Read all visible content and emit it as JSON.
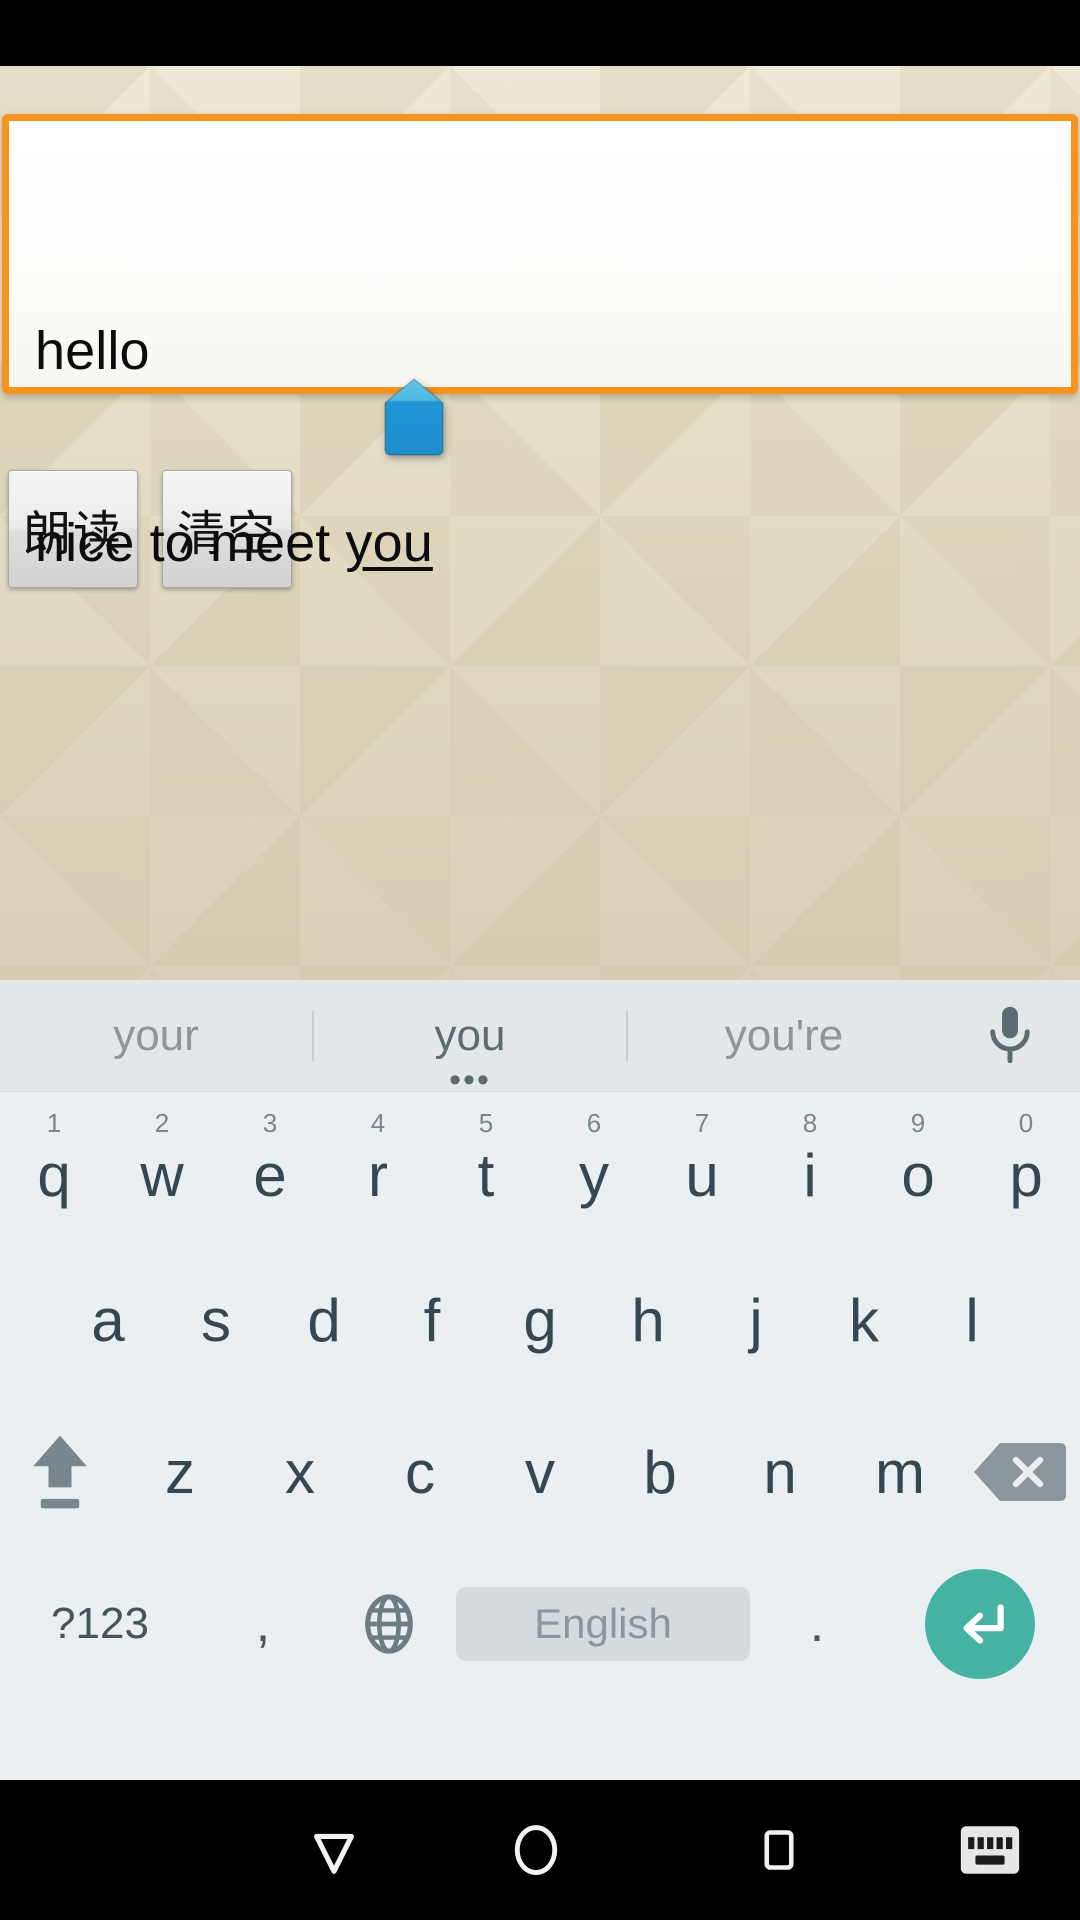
{
  "app": {
    "background_color": "#e2dac5",
    "accent_color": "#f6941e"
  },
  "editor": {
    "line1": "hello",
    "line2_prefix": "nice to meet ",
    "line2_composing": "you",
    "handle_icon": "text-cursor-handle-icon"
  },
  "buttons": [
    {
      "label": "朗读",
      "name": "read-aloud-button"
    },
    {
      "label": "清空",
      "name": "clear-button"
    }
  ],
  "keyboard": {
    "language_label": "English",
    "symbols_key": "?123",
    "comma_key": ",",
    "period_key": ".",
    "globe_icon": "globe-icon",
    "enter_icon": "enter-return-icon",
    "shift_icon": "shift-up-arrow-icon",
    "backspace_icon": "backspace-delete-icon",
    "mic_icon": "microphone-icon",
    "suggestions": [
      {
        "text": "your",
        "active": false,
        "more": ""
      },
      {
        "text": "you",
        "active": true,
        "more": "•••"
      },
      {
        "text": "you're",
        "active": false,
        "more": ""
      }
    ],
    "row1": [
      {
        "letter": "q",
        "num": "1"
      },
      {
        "letter": "w",
        "num": "2"
      },
      {
        "letter": "e",
        "num": "3"
      },
      {
        "letter": "r",
        "num": "4"
      },
      {
        "letter": "t",
        "num": "5"
      },
      {
        "letter": "y",
        "num": "6"
      },
      {
        "letter": "u",
        "num": "7"
      },
      {
        "letter": "i",
        "num": "8"
      },
      {
        "letter": "o",
        "num": "9"
      },
      {
        "letter": "p",
        "num": "0"
      }
    ],
    "row2": [
      "a",
      "s",
      "d",
      "f",
      "g",
      "h",
      "j",
      "k",
      "l"
    ],
    "row3": [
      "z",
      "x",
      "c",
      "v",
      "b",
      "n",
      "m"
    ],
    "enter_color": "#45b2a4",
    "space_color": "#d5dade"
  },
  "navbar": {
    "back_icon": "back-ime-down-triangle-icon",
    "home_icon": "home-circle-icon",
    "recents_icon": "recents-square-icon",
    "keyboard_icon": "keyboard-indicator-icon"
  }
}
